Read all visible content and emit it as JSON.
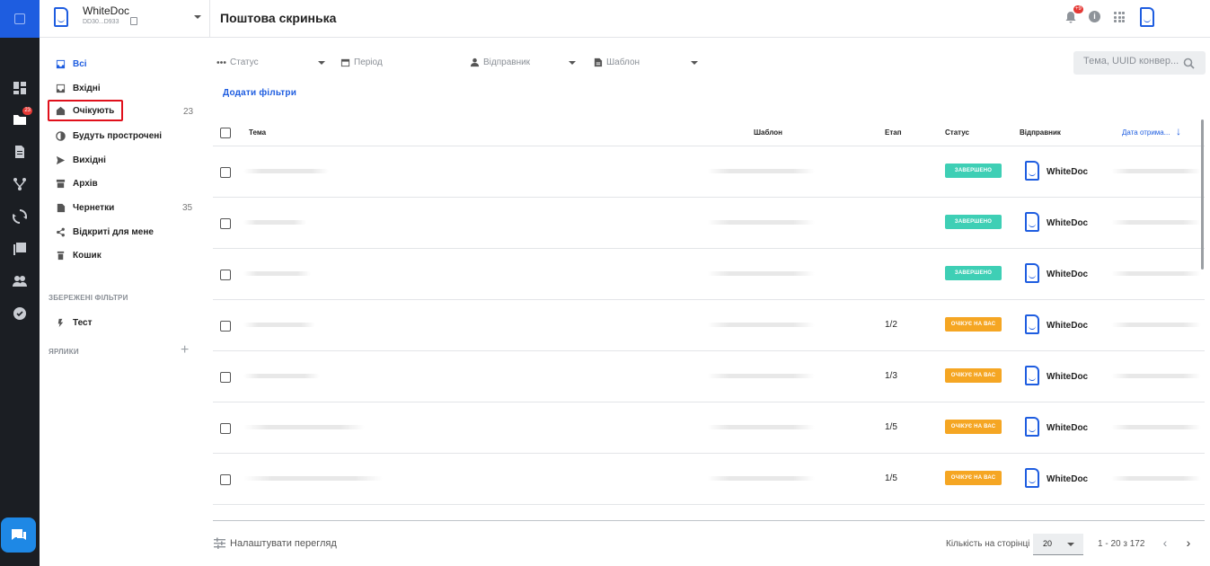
{
  "header": {
    "company_name": "WhiteDoc",
    "company_code": "DD30...D933",
    "page_title": "Поштова скринька",
    "notifications_badge": "+9"
  },
  "rail": {
    "documents_badge": "23",
    "items": [
      "dashboard-icon",
      "folder-icon",
      "document-icon",
      "workflow-icon",
      "sync-icon",
      "library-icon",
      "contacts-icon",
      "settings-icon",
      "chat-icon"
    ]
  },
  "sidebar": {
    "items": [
      {
        "label": "Всі",
        "count": ""
      },
      {
        "label": "Вхідні",
        "count": ""
      },
      {
        "label": "Очікують",
        "count": "23"
      },
      {
        "label": "Будуть прострочені",
        "count": ""
      },
      {
        "label": "Вихідні",
        "count": ""
      },
      {
        "label": "Архів",
        "count": ""
      },
      {
        "label": "Чернетки",
        "count": "35"
      },
      {
        "label": "Відкриті для мене",
        "count": ""
      },
      {
        "label": "Кошик",
        "count": ""
      }
    ],
    "saved_filters_heading": "ЗБЕРЕЖЕНІ ФІЛЬТРИ",
    "saved_filters": [
      {
        "label": "Тест"
      }
    ],
    "labels_heading": "ЯРЛИКИ"
  },
  "filters": {
    "status": "Статус",
    "period": "Період",
    "sender": "Відправник",
    "template": "Шаблон",
    "search_placeholder": "Тема, UUID конвер...",
    "add_filters": "Додати фільтри"
  },
  "table": {
    "columns": {
      "subject": "Тема",
      "template": "Шаблон",
      "stage": "Етап",
      "status": "Статус",
      "sender": "Відправник",
      "received_date": "Дата отрима..."
    },
    "rows": [
      {
        "stage": "",
        "status": "ЗАВЕРШЕНО",
        "status_kind": "done",
        "sender": "WhiteDoc"
      },
      {
        "stage": "",
        "status": "ЗАВЕРШЕНО",
        "status_kind": "done",
        "sender": "WhiteDoc"
      },
      {
        "stage": "",
        "status": "ЗАВЕРШЕНО",
        "status_kind": "done",
        "sender": "WhiteDoc"
      },
      {
        "stage": "1/2",
        "status": "ОЧІКУЄ НА ВАС",
        "status_kind": "wait",
        "sender": "WhiteDoc"
      },
      {
        "stage": "1/3",
        "status": "ОЧІКУЄ НА ВАС",
        "status_kind": "wait",
        "sender": "WhiteDoc"
      },
      {
        "stage": "1/5",
        "status": "ОЧІКУЄ НА ВАС",
        "status_kind": "wait",
        "sender": "WhiteDoc"
      },
      {
        "stage": "1/5",
        "status": "ОЧІКУЄ НА ВАС",
        "status_kind": "wait",
        "sender": "WhiteDoc"
      }
    ]
  },
  "footer": {
    "customize_view": "Налаштувати перегляд",
    "per_page_label": "Кількість на сторінці",
    "per_page_value": "20",
    "range": "1 - 20 з 172"
  },
  "colors": {
    "accent": "#1e5de0",
    "rail_bg": "#1b1e23",
    "done": "#3ecfb5",
    "wait": "#f5a623",
    "highlight": "#e0101b"
  }
}
